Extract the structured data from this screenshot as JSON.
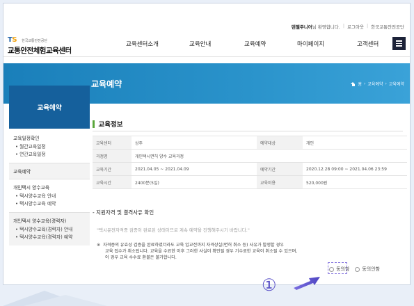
{
  "header": {
    "welcome_name": "덴젤주니어",
    "welcome_suffix": "님 환영합니다.",
    "logout": "로그아웃",
    "site_link": "한국교통안전공단",
    "logo_ts_t": "T",
    "logo_ts_s": "S",
    "logo_corp": "한국교통안전공단",
    "logo_center": "교통안전체험교육센터",
    "nav": [
      "교육센터소개",
      "교육안내",
      "교육예약",
      "마이페이지",
      "고객센터"
    ]
  },
  "band": {
    "title": "교육예약",
    "breadcrumb": [
      "홈",
      "교육예약",
      "교육예약"
    ]
  },
  "sidebar": {
    "title": "교육예약",
    "groups": [
      {
        "title": "교육일정확인",
        "subs": [
          "월간교육일정",
          "연간교육일정"
        ]
      },
      {
        "title": "교육예약",
        "subs": []
      },
      {
        "title": "개인택시 양수교육",
        "subs": [
          "택시양수교육 안내",
          "택시양수교육 예약"
        ]
      },
      {
        "title": "개인택시 양수교육(경력자)",
        "subs": [
          "택시양수교육(경력자) 안내",
          "택시양수교육(경력자) 예약"
        ]
      }
    ]
  },
  "content": {
    "section_title": "교육정보",
    "table": [
      [
        "교육센터",
        "상주",
        "예약대상",
        "개인"
      ],
      [
        "과정명",
        "개인택시면허 양수 교육과정",
        "",
        ""
      ],
      [
        "교육기간",
        "2021.04.05 ~ 2021.04.09",
        "예약기간",
        "2020.12.28 09:00 ~ 2021.04.06 23:59"
      ],
      [
        "교육시간",
        "2400분(5일)",
        "교육비용",
        "520,000원"
      ]
    ],
    "requirement_title": "지원자격 및 결격사유 확인",
    "quote": "\"택시운전자격증 검증이 완료된 상태이므로 계속 예약을 진행해주시기 바랍니다.\"",
    "notice_mark": "※",
    "notice_lines": [
      "자격증의 유효성 검증을 완료하였더라도 교육 입교전까지 자격상실(면허 취소 등) 사유가 발생할 경우",
      "교육 접수가 취소됩니다. 교육을 수료한 이후 그러한 사실이 확인될 경우 기수료한 교육이 취소될 수 있으며,",
      "이 경우 교육 수수료 환불은 불가합니다."
    ],
    "agree_label": "동의함",
    "disagree_label": "동의안함"
  },
  "annotation": {
    "step": "①"
  },
  "colors": {
    "band": "#2a93cb",
    "sidebar_head": "#15609c",
    "accent_green": "#5aa63b",
    "annotation": "#6a5fd6"
  }
}
